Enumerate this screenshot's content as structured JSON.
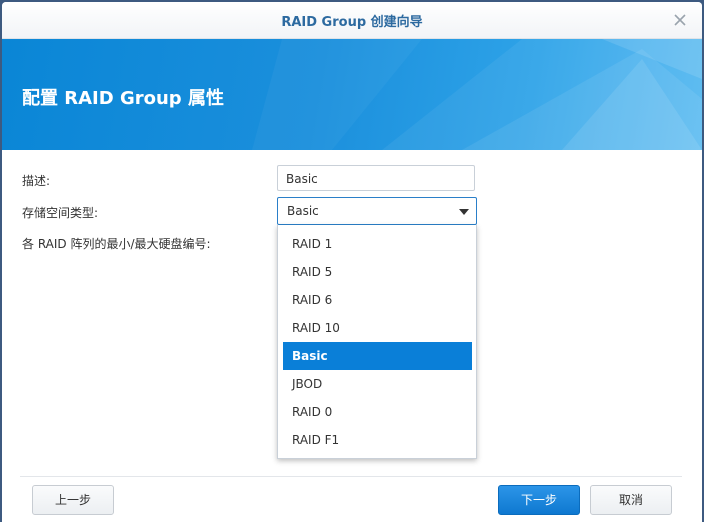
{
  "window": {
    "title": "RAID Group 创建向导"
  },
  "banner": {
    "title": "配置 RAID Group 属性",
    "color": "#1b8fdc"
  },
  "form": {
    "description_label": "描述:",
    "description_value": "Basic",
    "storage_type_label": "存储空间类型:",
    "storage_type_value": "Basic",
    "raid_disk_count_label": "各 RAID 阵列的最小/最大硬盘编号:"
  },
  "dropdown": {
    "options": [
      "RAID 1",
      "RAID 5",
      "RAID 6",
      "RAID 10",
      "Basic",
      "JBOD",
      "RAID 0",
      "RAID F1"
    ],
    "selected": "Basic"
  },
  "footer": {
    "prev_label": "上一步",
    "next_label": "下一步",
    "cancel_label": "取消"
  },
  "icons": {
    "close": "close-icon",
    "dropdown": "chevron-down-icon"
  },
  "colors": {
    "accent": "#0a7fd8",
    "title_text": "#2d6aa0"
  }
}
